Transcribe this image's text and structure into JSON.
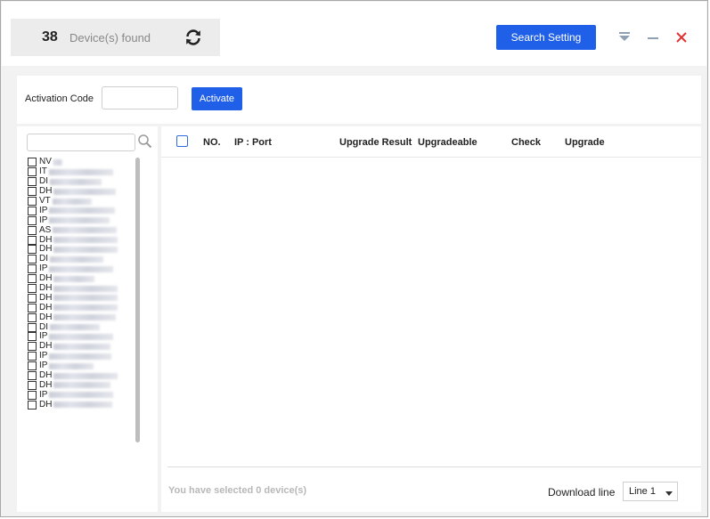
{
  "header": {
    "device_count": "38",
    "found_label": "Device(s) found",
    "search_setting_label": "Search Setting"
  },
  "activation": {
    "label": "Activation Code",
    "input_value": "",
    "button_label": "Activate"
  },
  "device_search": {
    "value": ""
  },
  "devices": [
    {
      "prefix": "NV",
      "w": 10
    },
    {
      "prefix": "IT",
      "w": 72
    },
    {
      "prefix": "DI",
      "w": 58
    },
    {
      "prefix": "DH",
      "w": 70
    },
    {
      "prefix": "VT",
      "w": 44
    },
    {
      "prefix": "IP",
      "w": 74
    },
    {
      "prefix": "IP",
      "w": 68
    },
    {
      "prefix": "AS",
      "w": 72
    },
    {
      "prefix": "DH",
      "w": 72
    },
    {
      "prefix": "DH",
      "w": 72
    },
    {
      "prefix": "DI",
      "w": 60
    },
    {
      "prefix": "IP",
      "w": 72
    },
    {
      "prefix": "DH",
      "w": 46
    },
    {
      "prefix": "DH",
      "w": 72
    },
    {
      "prefix": "DH",
      "w": 72
    },
    {
      "prefix": "DH",
      "w": 72
    },
    {
      "prefix": "DH",
      "w": 70
    },
    {
      "prefix": "DI",
      "w": 56
    },
    {
      "prefix": "IP",
      "w": 72
    },
    {
      "prefix": "DH",
      "w": 64
    },
    {
      "prefix": "IP",
      "w": 70
    },
    {
      "prefix": "IP",
      "w": 50
    },
    {
      "prefix": "DH",
      "w": 72
    },
    {
      "prefix": "DH",
      "w": 64
    },
    {
      "prefix": "IP",
      "w": 72
    },
    {
      "prefix": "DH",
      "w": 66
    }
  ],
  "table": {
    "columns": [
      "NO.",
      "IP : Port",
      "Upgrade Result",
      "Upgradeable",
      "Check",
      "Upgrade"
    ]
  },
  "footer": {
    "selected_text": "You have selected 0  device(s)",
    "download_label": "Download line",
    "download_value": "Line 1"
  },
  "colors": {
    "accent": "#2060e8",
    "close": "#e03030"
  }
}
